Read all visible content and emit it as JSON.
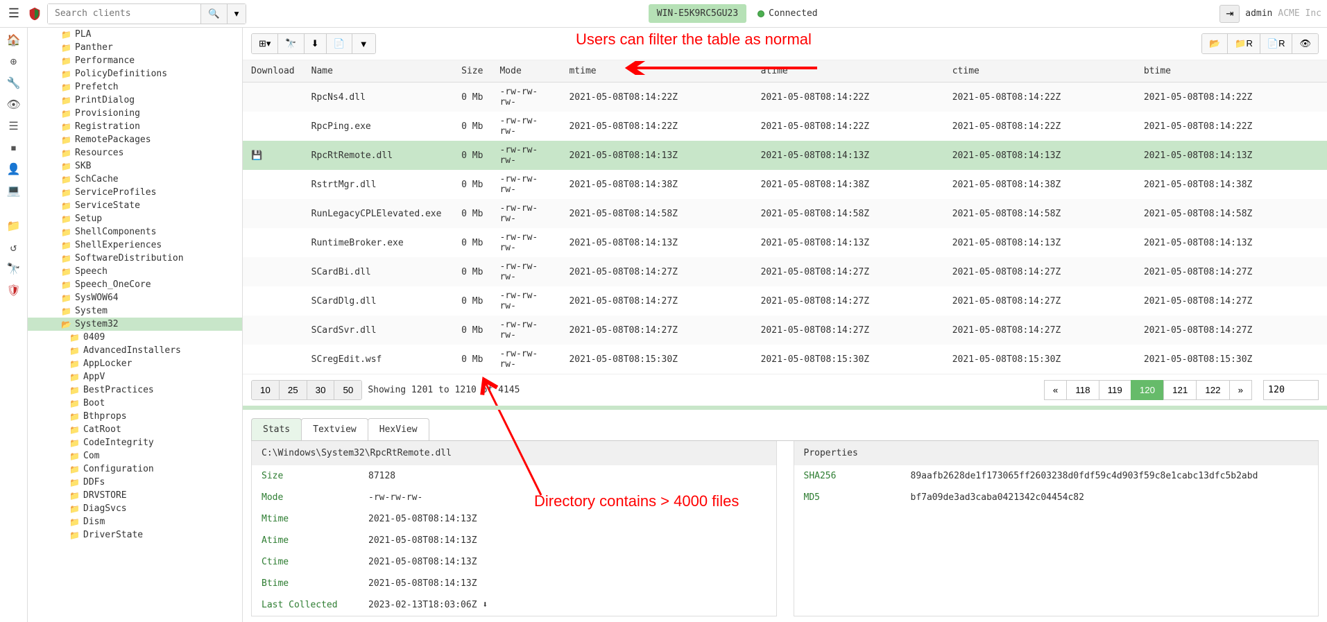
{
  "header": {
    "search_placeholder": "Search clients",
    "host": "WIN-E5K9RC5GU23",
    "status": "Connected",
    "user": "admin",
    "org": "ACME Inc"
  },
  "sidebar": {
    "folders": [
      {
        "name": "PLA",
        "sub": false
      },
      {
        "name": "Panther",
        "sub": false
      },
      {
        "name": "Performance",
        "sub": false
      },
      {
        "name": "PolicyDefinitions",
        "sub": false
      },
      {
        "name": "Prefetch",
        "sub": false
      },
      {
        "name": "PrintDialog",
        "sub": false
      },
      {
        "name": "Provisioning",
        "sub": false
      },
      {
        "name": "Registration",
        "sub": false
      },
      {
        "name": "RemotePackages",
        "sub": false
      },
      {
        "name": "Resources",
        "sub": false
      },
      {
        "name": "SKB",
        "sub": false
      },
      {
        "name": "SchCache",
        "sub": false
      },
      {
        "name": "ServiceProfiles",
        "sub": false
      },
      {
        "name": "ServiceState",
        "sub": false
      },
      {
        "name": "Setup",
        "sub": false
      },
      {
        "name": "ShellComponents",
        "sub": false
      },
      {
        "name": "ShellExperiences",
        "sub": false
      },
      {
        "name": "SoftwareDistribution",
        "sub": false
      },
      {
        "name": "Speech",
        "sub": false
      },
      {
        "name": "Speech_OneCore",
        "sub": false
      },
      {
        "name": "SysWOW64",
        "sub": false
      },
      {
        "name": "System",
        "sub": false
      },
      {
        "name": "System32",
        "sub": false,
        "selected": true,
        "open": true
      },
      {
        "name": "0409",
        "sub": true
      },
      {
        "name": "AdvancedInstallers",
        "sub": true
      },
      {
        "name": "AppLocker",
        "sub": true
      },
      {
        "name": "AppV",
        "sub": true
      },
      {
        "name": "BestPractices",
        "sub": true
      },
      {
        "name": "Boot",
        "sub": true
      },
      {
        "name": "Bthprops",
        "sub": true
      },
      {
        "name": "CatRoot",
        "sub": true
      },
      {
        "name": "CodeIntegrity",
        "sub": true
      },
      {
        "name": "Com",
        "sub": true
      },
      {
        "name": "Configuration",
        "sub": true
      },
      {
        "name": "DDFs",
        "sub": true
      },
      {
        "name": "DRVSTORE",
        "sub": true
      },
      {
        "name": "DiagSvcs",
        "sub": true
      },
      {
        "name": "Dism",
        "sub": true
      },
      {
        "name": "DriverState",
        "sub": true
      }
    ]
  },
  "annotations": {
    "filter_text": "Users can filter the table as normal",
    "count_text": "Directory contains > 4000 files"
  },
  "table": {
    "headers": {
      "download": "Download",
      "name": "Name",
      "size": "Size",
      "mode": "Mode",
      "mtime": "mtime",
      "atime": "atime",
      "ctime": "ctime",
      "btime": "btime"
    },
    "rows": [
      {
        "name": "RpcNs4.dll",
        "size": "0 Mb",
        "mode": "-rw-rw-rw-",
        "mtime": "2021-05-08T08:14:22Z",
        "atime": "2021-05-08T08:14:22Z",
        "ctime": "2021-05-08T08:14:22Z",
        "btime": "2021-05-08T08:14:22Z"
      },
      {
        "name": "RpcPing.exe",
        "size": "0 Mb",
        "mode": "-rw-rw-rw-",
        "mtime": "2021-05-08T08:14:22Z",
        "atime": "2021-05-08T08:14:22Z",
        "ctime": "2021-05-08T08:14:22Z",
        "btime": "2021-05-08T08:14:22Z"
      },
      {
        "name": "RpcRtRemote.dll",
        "size": "0 Mb",
        "mode": "-rw-rw-rw-",
        "mtime": "2021-05-08T08:14:13Z",
        "atime": "2021-05-08T08:14:13Z",
        "ctime": "2021-05-08T08:14:13Z",
        "btime": "2021-05-08T08:14:13Z",
        "selected": true,
        "dl": true
      },
      {
        "name": "RstrtMgr.dll",
        "size": "0 Mb",
        "mode": "-rw-rw-rw-",
        "mtime": "2021-05-08T08:14:38Z",
        "atime": "2021-05-08T08:14:38Z",
        "ctime": "2021-05-08T08:14:38Z",
        "btime": "2021-05-08T08:14:38Z"
      },
      {
        "name": "RunLegacyCPLElevated.exe",
        "size": "0 Mb",
        "mode": "-rw-rw-rw-",
        "mtime": "2021-05-08T08:14:58Z",
        "atime": "2021-05-08T08:14:58Z",
        "ctime": "2021-05-08T08:14:58Z",
        "btime": "2021-05-08T08:14:58Z"
      },
      {
        "name": "RuntimeBroker.exe",
        "size": "0 Mb",
        "mode": "-rw-rw-rw-",
        "mtime": "2021-05-08T08:14:13Z",
        "atime": "2021-05-08T08:14:13Z",
        "ctime": "2021-05-08T08:14:13Z",
        "btime": "2021-05-08T08:14:13Z"
      },
      {
        "name": "SCardBi.dll",
        "size": "0 Mb",
        "mode": "-rw-rw-rw-",
        "mtime": "2021-05-08T08:14:27Z",
        "atime": "2021-05-08T08:14:27Z",
        "ctime": "2021-05-08T08:14:27Z",
        "btime": "2021-05-08T08:14:27Z"
      },
      {
        "name": "SCardDlg.dll",
        "size": "0 Mb",
        "mode": "-rw-rw-rw-",
        "mtime": "2021-05-08T08:14:27Z",
        "atime": "2021-05-08T08:14:27Z",
        "ctime": "2021-05-08T08:14:27Z",
        "btime": "2021-05-08T08:14:27Z"
      },
      {
        "name": "SCardSvr.dll",
        "size": "0 Mb",
        "mode": "-rw-rw-rw-",
        "mtime": "2021-05-08T08:14:27Z",
        "atime": "2021-05-08T08:14:27Z",
        "ctime": "2021-05-08T08:14:27Z",
        "btime": "2021-05-08T08:14:27Z"
      },
      {
        "name": "SCregEdit.wsf",
        "size": "0 Mb",
        "mode": "-rw-rw-rw-",
        "mtime": "2021-05-08T08:15:30Z",
        "atime": "2021-05-08T08:15:30Z",
        "ctime": "2021-05-08T08:15:30Z",
        "btime": "2021-05-08T08:15:30Z"
      }
    ]
  },
  "pager": {
    "sizes": [
      "10",
      "25",
      "30",
      "50"
    ],
    "text": "Showing 1201 to 1210 of 4145",
    "pages": [
      "«",
      "118",
      "119",
      "120",
      "121",
      "122",
      "»"
    ],
    "active_page": "120",
    "page_input": "120"
  },
  "detail": {
    "tabs": {
      "stats": "Stats",
      "textview": "Textview",
      "hexview": "HexView"
    },
    "path": "C:\\Windows\\System32\\RpcRtRemote.dll",
    "props_header": "Properties",
    "stats": {
      "size_l": "Size",
      "size_v": "87128",
      "mode_l": "Mode",
      "mode_v": "-rw-rw-rw-",
      "mtime_l": "Mtime",
      "mtime_v": "2021-05-08T08:14:13Z",
      "atime_l": "Atime",
      "atime_v": "2021-05-08T08:14:13Z",
      "ctime_l": "Ctime",
      "ctime_v": "2021-05-08T08:14:13Z",
      "btime_l": "Btime",
      "btime_v": "2021-05-08T08:14:13Z",
      "lc_l": "Last Collected",
      "lc_v": "2023-02-13T18:03:06Z"
    },
    "hashes": {
      "sha256_l": "SHA256",
      "sha256_v": "89aafb2628de1f173065ff2603238d0fdf59c4d903f59c8e1cabc13dfc5b2abd",
      "md5_l": "MD5",
      "md5_v": "bf7a09de3ad3caba0421342c04454c82"
    }
  }
}
